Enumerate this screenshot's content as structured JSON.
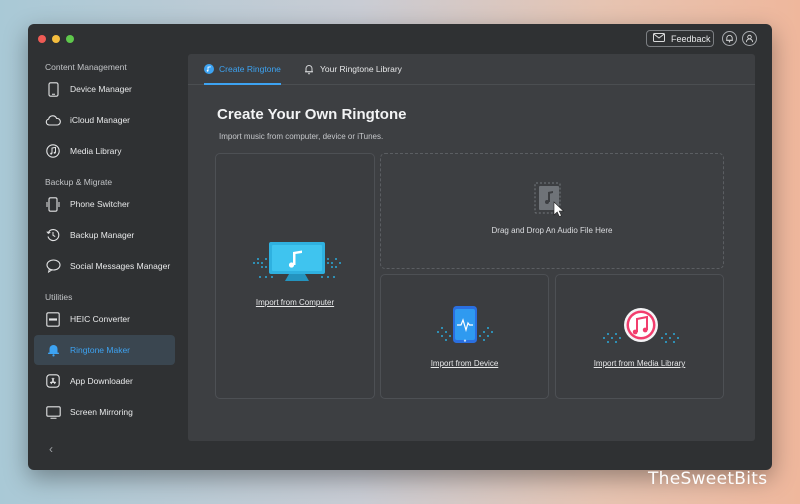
{
  "window": {
    "feedback_label": "Feedback",
    "feedback_icon": "mail-icon",
    "bell_icon": "bell-icon",
    "account_icon": "user-icon"
  },
  "sidebar": {
    "sections": [
      {
        "title": "Content Management"
      },
      {
        "title": "Backup & Migrate"
      },
      {
        "title": "Utilities"
      }
    ],
    "items": [
      {
        "label": "Device Manager",
        "icon": "phone-icon"
      },
      {
        "label": "iCloud Manager",
        "icon": "cloud-icon"
      },
      {
        "label": "Media Library",
        "icon": "music-icon"
      },
      {
        "label": "Phone Switcher",
        "icon": "phone-switch-icon"
      },
      {
        "label": "Backup Manager",
        "icon": "backup-icon"
      },
      {
        "label": "Social Messages Manager",
        "icon": "chat-icon"
      },
      {
        "label": "HEIC Converter",
        "icon": "heic-icon"
      },
      {
        "label": "Ringtone Maker",
        "icon": "bell-icon",
        "active": true
      },
      {
        "label": "App Downloader",
        "icon": "app-store-icon"
      },
      {
        "label": "Screen Mirroring",
        "icon": "screen-icon"
      }
    ],
    "collapse_glyph": "‹"
  },
  "tabs": [
    {
      "label": "Create Ringtone",
      "active": true,
      "icon": "ringtone-icon"
    },
    {
      "label": "Your Ringtone Library",
      "active": false,
      "icon": "bell-icon"
    }
  ],
  "content": {
    "title": "Create Your Own Ringtone",
    "subtitle": "Import music from computer, device or iTunes.",
    "import_computer": "Import from Computer",
    "drag_drop": "Drag and Drop An Audio File Here",
    "import_device": "Import from Device",
    "import_media": "Import from Media Library"
  },
  "colors": {
    "accent": "#3da3f2",
    "sidebar_bg": "#2f3133",
    "panel_bg": "#3d3f42"
  },
  "watermark": "TheSweetBits"
}
